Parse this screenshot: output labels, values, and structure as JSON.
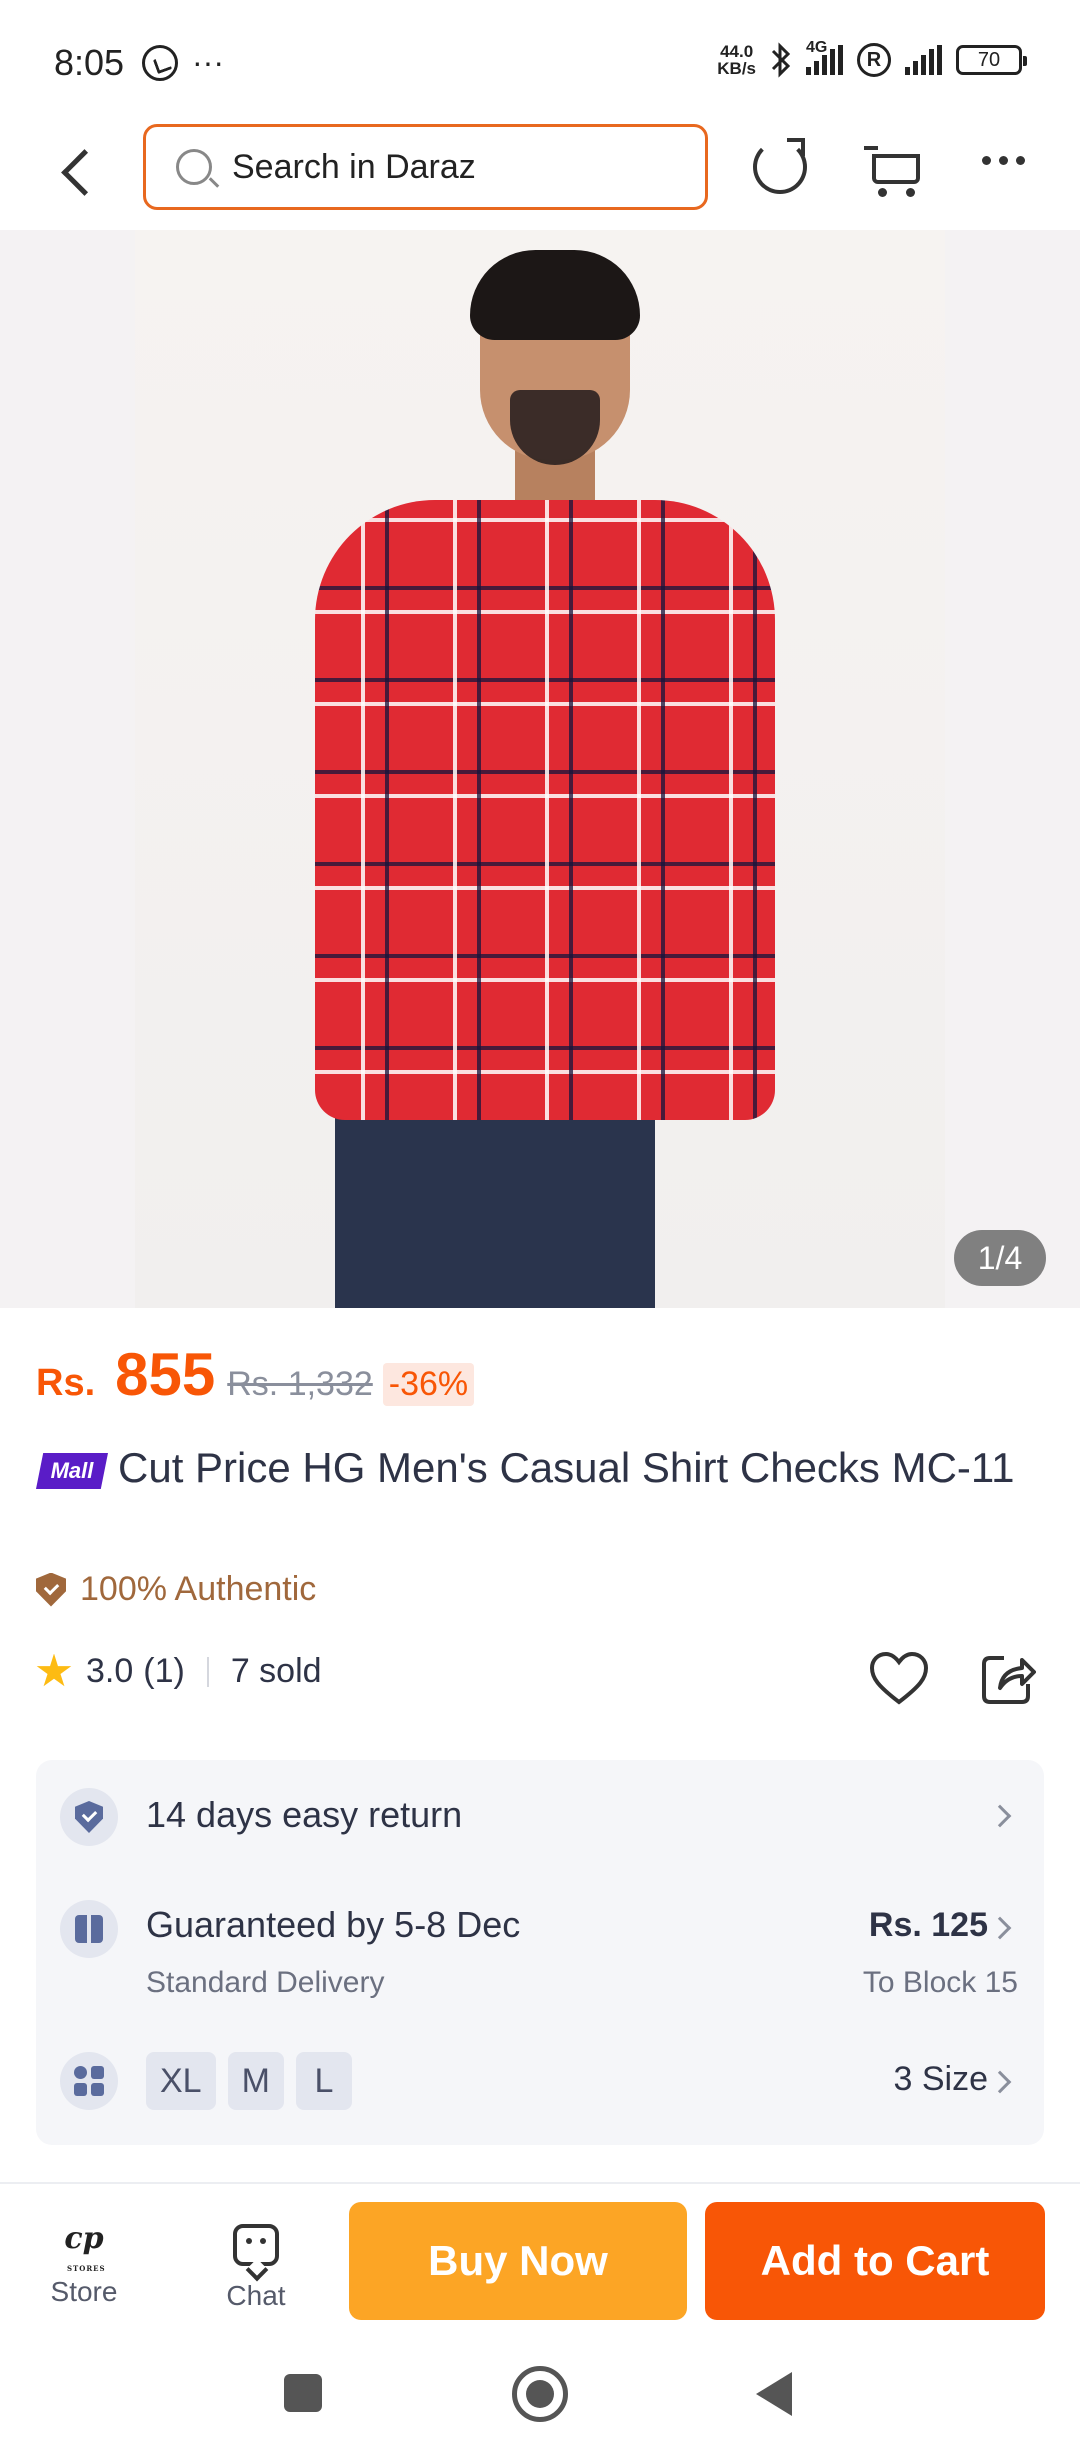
{
  "status_bar": {
    "time": "8:05",
    "overflow": "···",
    "net_speed_value": "44.0",
    "net_speed_unit": "KB/s",
    "network_type": "4G",
    "battery": "70"
  },
  "top_bar": {
    "search_placeholder": "Search in Daraz"
  },
  "gallery": {
    "counter": "1/4"
  },
  "price": {
    "currency": "Rs.",
    "current": "855",
    "original": "Rs. 1,332",
    "discount": "-36%"
  },
  "product": {
    "mall_badge": "Mall",
    "title": "Cut Price HG Men's Casual Shirt Checks MC-11",
    "authentic_label": "100% Authentic",
    "rating": "3.0",
    "rating_count": "(1)",
    "sold": "7 sold"
  },
  "services": {
    "return_label": "14 days easy return",
    "delivery_label": "Guaranteed by 5-8 Dec",
    "delivery_type": "Standard Delivery",
    "delivery_fee": "Rs. 125",
    "delivery_to": "To Block 15",
    "sizes": [
      "XL",
      "M",
      "L"
    ],
    "size_count": "3 Size"
  },
  "actions": {
    "store_label": "Store",
    "chat_label": "Chat",
    "buy_now": "Buy Now",
    "add_to_cart": "Add to Cart"
  },
  "colors": {
    "accent": "#f85606",
    "buy_now": "#fca525",
    "mall": "#5a1cc7",
    "authentic": "#a0683c",
    "star": "#fdbb13"
  }
}
